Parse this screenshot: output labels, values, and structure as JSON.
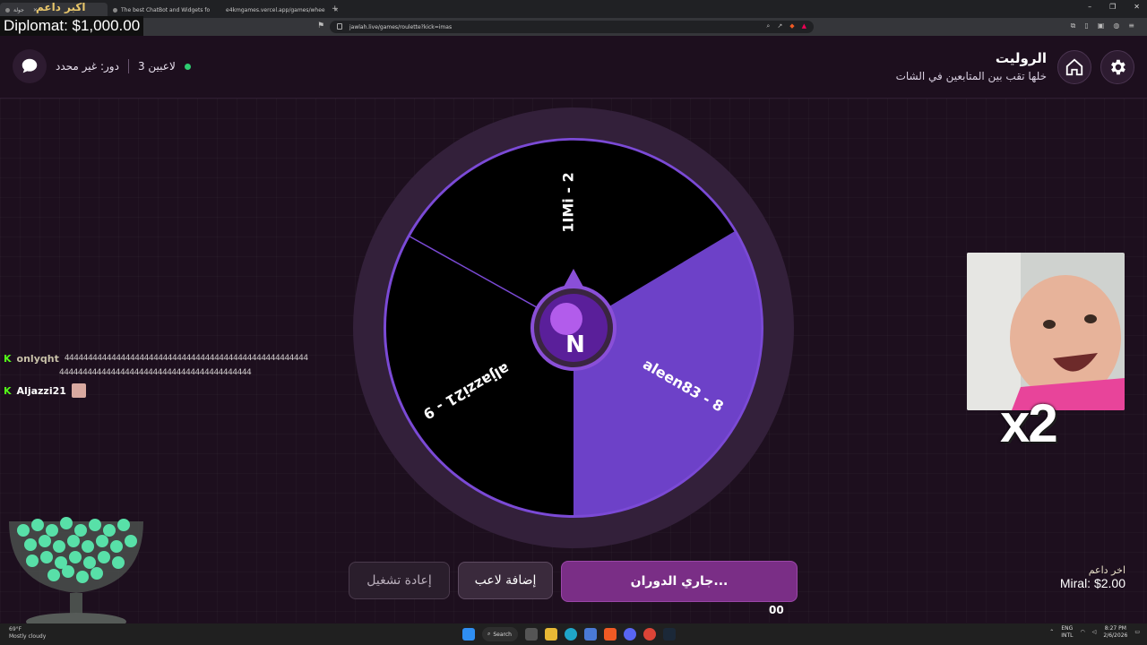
{
  "browser": {
    "tabs": [
      {
        "label": "جولة",
        "active": true
      },
      {
        "label": "The best ChatBot and Widgets fo",
        "active": false
      },
      {
        "label": "e4kmgames.vercel.app/games/whee",
        "active": false
      }
    ],
    "url": "jawlah.live/games/roulette?kick=imas"
  },
  "overlay": {
    "diplomat": "Diplomat: $1,000.00",
    "top_supporter_label": "اكبر داعم"
  },
  "header": {
    "title": "الروليت",
    "subtitle": "خلها تقب بين المتابعين في الشات",
    "players_count": "3 لاعبين",
    "turn": "دور: غير محدد"
  },
  "wheel": {
    "segments": [
      {
        "label": "1IMi - 2",
        "color": "#000000"
      },
      {
        "label": "aleen83 - 8",
        "color": "#6d41c8"
      },
      {
        "label": "aljazzi21 - 9",
        "color": "#000000"
      }
    ],
    "ring_color": "#3a2540",
    "border_color": "#7b4ad6"
  },
  "chat": [
    {
      "user": "onlyqht",
      "message": "4444444444444444444444444444444444444444444444444444"
    },
    {
      "user": "",
      "message": "44444444444444444444444444444444444444444"
    },
    {
      "user": "Aljazzi21",
      "message": ""
    }
  ],
  "emote": {
    "multiplier": "x2"
  },
  "buttons": {
    "spin": "جاري الدوران...",
    "add_player": "إضافة لاعب",
    "restart": "إعادة تشغيل"
  },
  "last_supporter": {
    "label": "اخر داعم",
    "value": "Miral: $2.00"
  },
  "ticker": "00",
  "taskbar": {
    "weather_temp": "69°F",
    "weather_desc": "Mostly cloudy",
    "search": "Search",
    "lang": "ENG",
    "region": "INTL",
    "time": "8:27 PM",
    "date": "2/6/2026"
  }
}
